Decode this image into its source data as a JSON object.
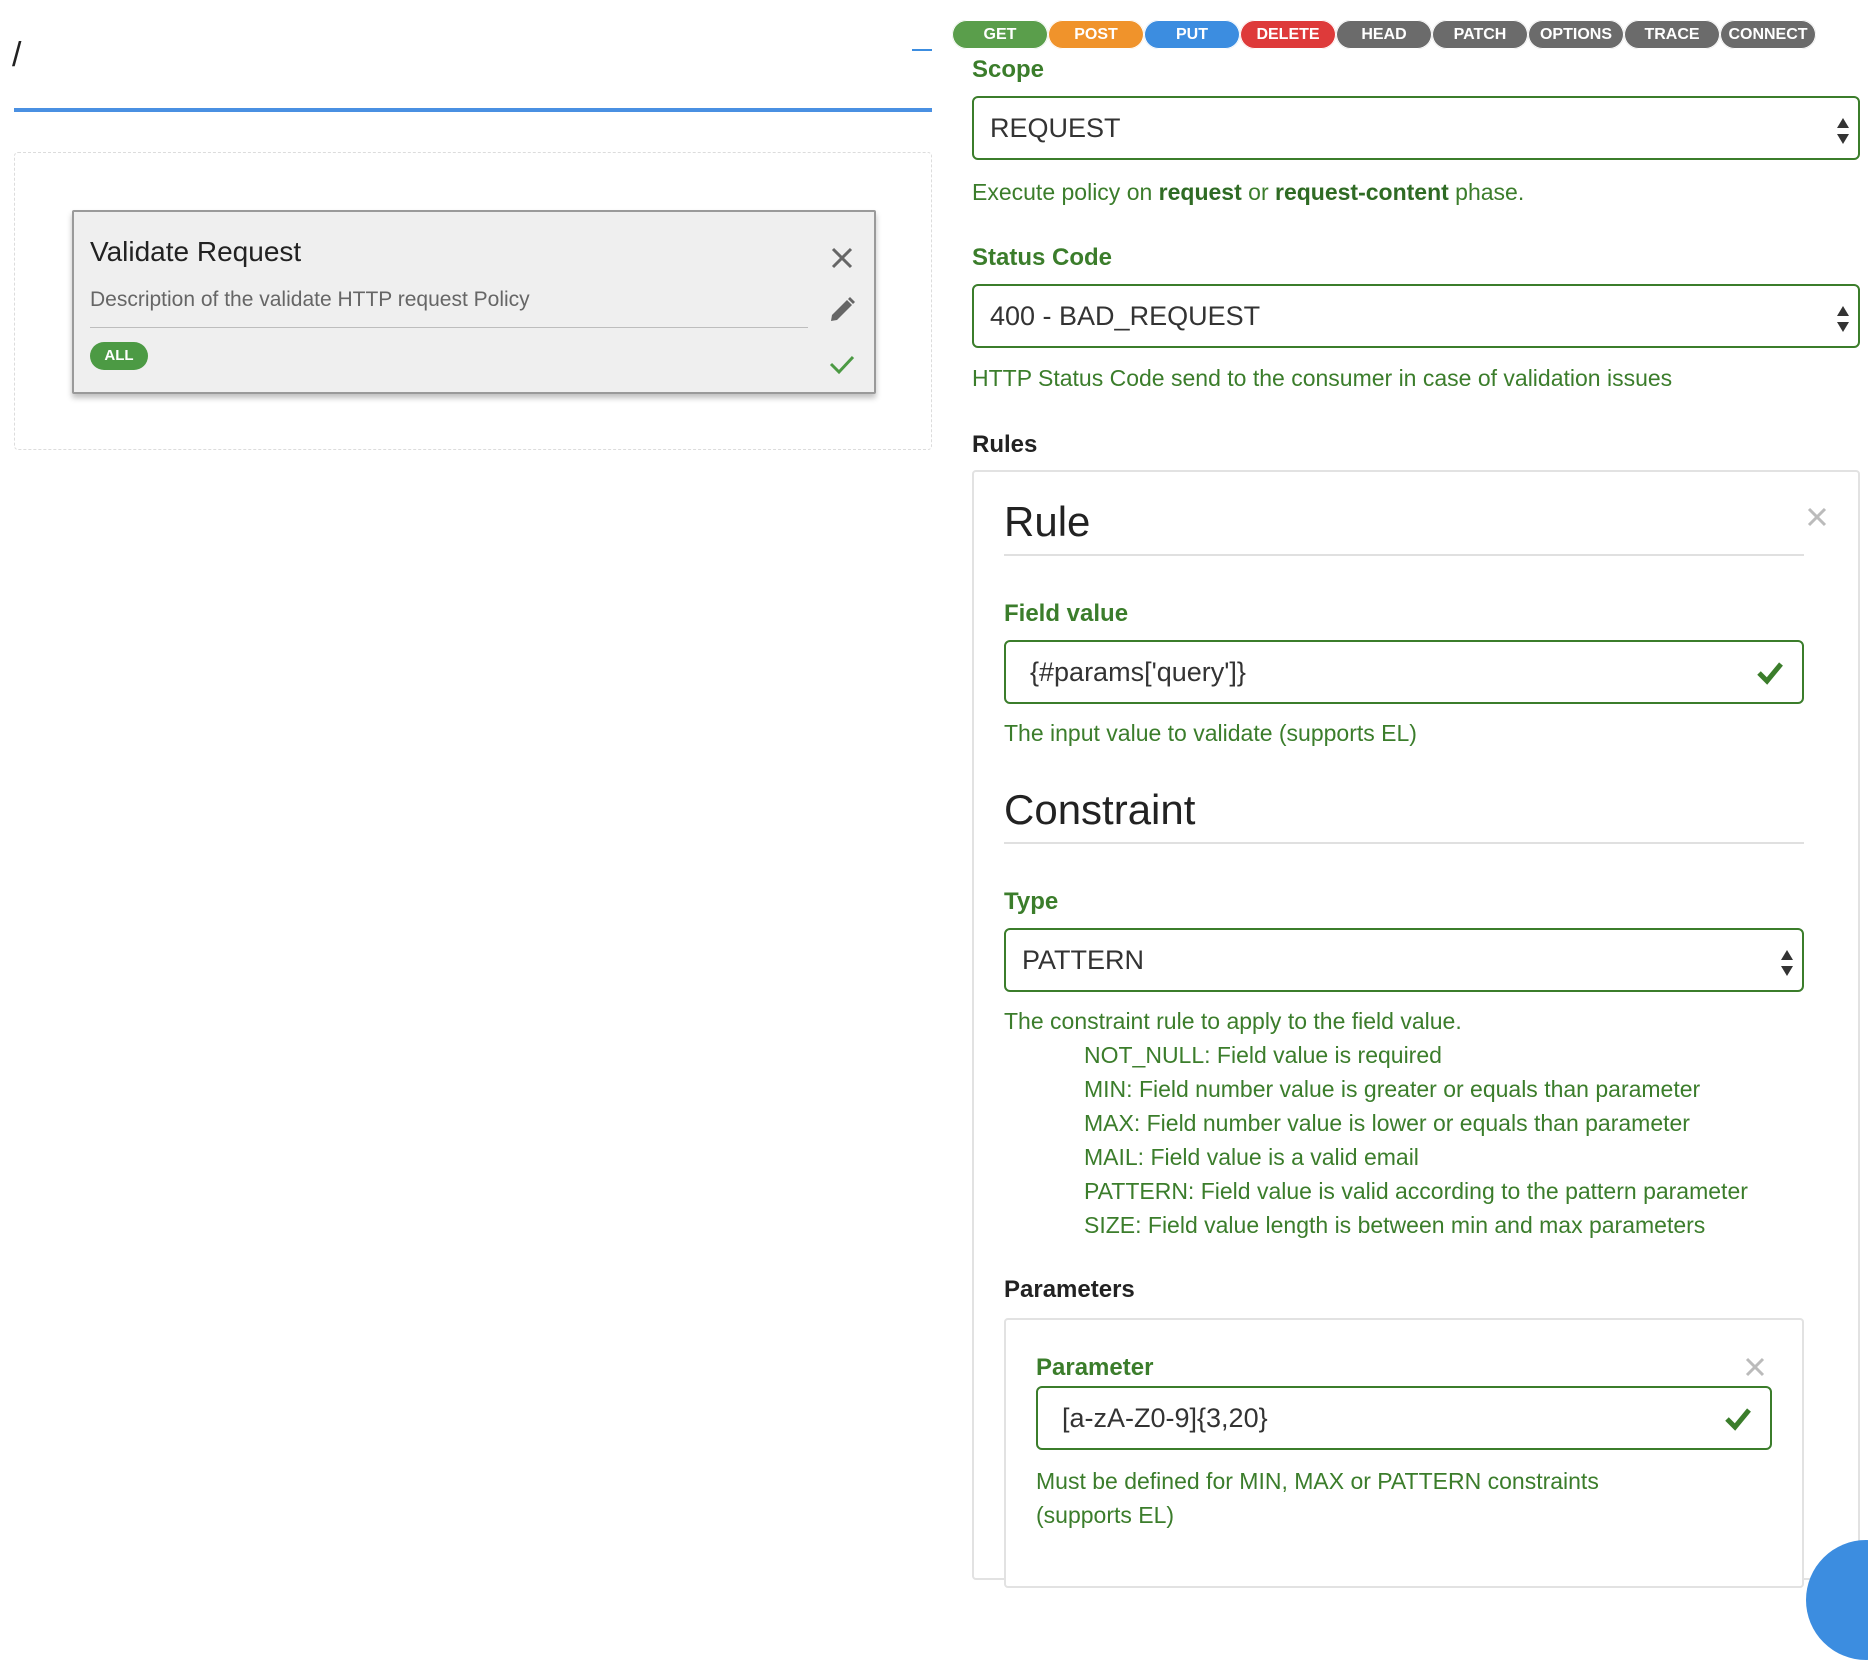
{
  "flow": {
    "path": "/",
    "policy": {
      "name": "Validate Request",
      "description": "Description of the validate HTTP request Policy",
      "badge": "ALL"
    }
  },
  "methods": [
    "GET",
    "POST",
    "PUT",
    "DELETE",
    "HEAD",
    "PATCH",
    "OPTIONS",
    "TRACE",
    "CONNECT"
  ],
  "method_colors": [
    "#5a9e4b",
    "#f0932b",
    "#3c8de0",
    "#de3a3a",
    "#6b6b6b",
    "#6b6b6b",
    "#6b6b6b",
    "#6b6b6b",
    "#6b6b6b"
  ],
  "form": {
    "scope": {
      "label": "Scope",
      "value": "REQUEST",
      "help_before": "Execute policy on ",
      "help_bold1": "request",
      "help_mid": " or ",
      "help_bold2": "request-content",
      "help_after": " phase."
    },
    "status_code": {
      "label": "Status Code",
      "value": "400 - BAD_REQUEST",
      "help": "HTTP Status Code send to the consumer in case of validation issues"
    },
    "rules": {
      "label": "Rules",
      "rule_title": "Rule",
      "field_value": {
        "label": "Field value",
        "value": "{#params['query']}",
        "help": "The input value to validate (supports EL)"
      },
      "constraint_title": "Constraint",
      "type": {
        "label": "Type",
        "value": "PATTERN",
        "help": "The constraint rule to apply to the field value.",
        "options_help": [
          "NOT_NULL: Field value is required",
          "MIN: Field number value is greater or equals than parameter",
          "MAX: Field number value is lower or equals than parameter",
          "MAIL: Field value is a valid email",
          "PATTERN: Field value is valid according to the pattern parameter",
          "SIZE: Field value length is between min and max parameters"
        ]
      },
      "parameters": {
        "label": "Parameters",
        "parameter_label": "Parameter",
        "parameter_value": "[a-zA-Z0-9]{3,20}",
        "help_line1": "Must be defined for MIN, MAX or PATTERN constraints",
        "help_line2": "(supports EL)"
      }
    }
  },
  "icons": {
    "remove_policy": "close-icon",
    "edit_policy": "pencil-icon",
    "save_policy": "check-icon",
    "select_arrows": "sort-arrows-icon",
    "valid": "checkmark-icon",
    "remove_rule": "close-icon"
  },
  "colors": {
    "accent_blue": "#4a90e2",
    "form_green": "#3b7d2b",
    "badge_green": "#4c9a44"
  }
}
